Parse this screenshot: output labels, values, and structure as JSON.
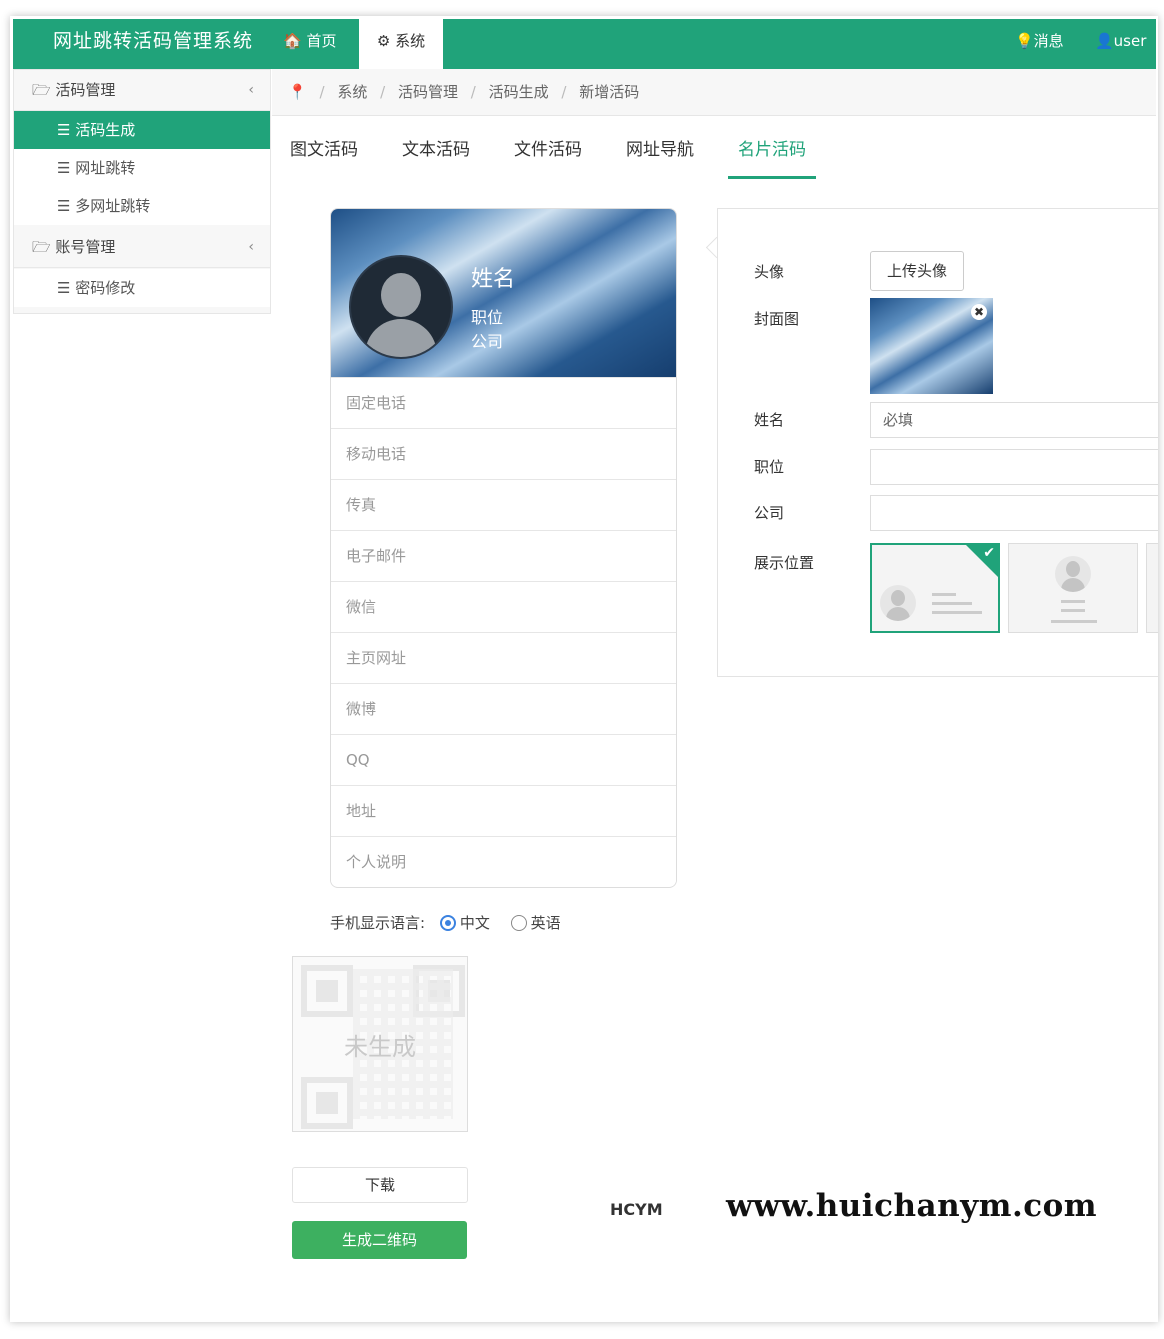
{
  "header": {
    "brand": "网址跳转活码管理系统",
    "nav_home": "🏠 首页",
    "nav_system": "⚙ 系统",
    "nav_messages": "💡消息",
    "nav_user": "👤user ▾"
  },
  "sidebar": {
    "group1": {
      "label": "🗁 活码管理",
      "chevron": "‹"
    },
    "items": [
      {
        "label": "☰ 活码生成"
      },
      {
        "label": "☰ 网址跳转"
      },
      {
        "label": "☰ 多网址跳转"
      }
    ],
    "group2": {
      "label": "🗁 账号管理",
      "chevron": "‹"
    },
    "group2_items": [
      {
        "label": "☰ 密码修改"
      }
    ]
  },
  "breadcrumb": {
    "icon": "📍",
    "items": [
      "系统",
      "活码管理",
      "活码生成",
      "新增活码"
    ],
    "sep": "/"
  },
  "tabs": [
    "图文活码",
    "文本活码",
    "文件活码",
    "网址导航",
    "名片活码"
  ],
  "active_tab": "名片活码",
  "preview": {
    "name": "姓名",
    "title": "职位",
    "company": "公司",
    "fields": [
      "固定电话",
      "移动电话",
      "传真",
      "电子邮件",
      "微信",
      "主页网址",
      "微博",
      "QQ",
      "地址",
      "个人说明"
    ]
  },
  "language": {
    "label": "手机显示语言:",
    "options": [
      "中文",
      "英语"
    ],
    "selected": "中文"
  },
  "qr": {
    "status": "未生成"
  },
  "buttons": {
    "download": "下载",
    "generate": "生成二维码",
    "upload_avatar": "上传头像"
  },
  "form": {
    "avatar_label": "头像",
    "cover_label": "封面图",
    "name_label": "姓名",
    "name_placeholder": "必填",
    "title_label": "职位",
    "company_label": "公司",
    "position_label": "展示位置",
    "close": "✖",
    "check": "✔"
  },
  "watermark": {
    "logo": "HCYM",
    "url": "www.huichanym.com"
  },
  "colors": {
    "brand": "#20a37a",
    "generate_button": "#3db060",
    "radio_selected": "#3b82e0"
  }
}
